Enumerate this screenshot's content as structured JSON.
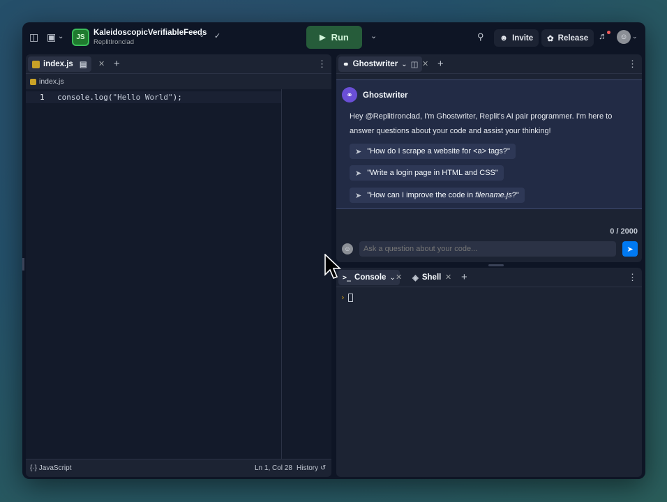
{
  "topbar": {
    "repl_name": "KaleidoscopicVerifiableFeeds",
    "repl_owner": "ReplitIronclad",
    "repl_lang_badge": "JS",
    "run_label": "Run",
    "invite_label": "Invite",
    "release_label": "Release"
  },
  "editor": {
    "tab_label": "index.js",
    "breadcrumb": "index.js",
    "line_number": "1",
    "code_prefix": "console.log(",
    "code_string": "\"Hello World\"",
    "code_suffix": ");",
    "language": "JavaScript",
    "cursor_position": "Ln 1, Col 28",
    "history_label": "History"
  },
  "ghostwriter": {
    "tab_label": "Ghostwriter",
    "name": "Ghostwriter",
    "intro": "Hey @ReplitIronclad, I'm Ghostwriter, Replit's AI pair programmer. I'm here to answer questions about your code and assist your thinking!",
    "suggestions": [
      "\"How do I scrape a website for <a> tags?\"",
      "\"Write a login page in HTML and CSS\"",
      "\"How can I improve the code in "
    ],
    "suggestion3_file": "filename.js",
    "suggestion3_end": "?\"",
    "char_counter": "0 / 2000",
    "input_placeholder": "Ask a question about your code..."
  },
  "console": {
    "console_tab": "Console",
    "shell_tab": "Shell",
    "prompt": "›"
  },
  "colors": {
    "background": "#0e1525",
    "panel": "#1c2333",
    "run_button": "#265c3a",
    "send_button": "#0079f2"
  }
}
